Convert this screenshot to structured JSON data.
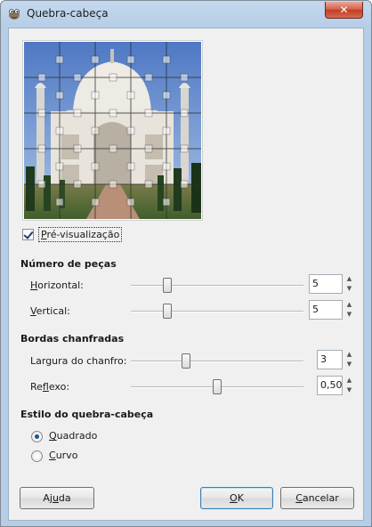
{
  "window": {
    "title": "Quebra-cabeça",
    "close_glyph": "✕",
    "icon": "gimp-icon"
  },
  "preview_toggle": {
    "label_mnemonic": "P",
    "label_rest": "ré-visualização",
    "checked": true
  },
  "pieces": {
    "heading": "Número de peças",
    "horizontal": {
      "label_mnemonic": "H",
      "label_rest": "orizontal:",
      "value": "5",
      "fraction": 0.21
    },
    "vertical": {
      "label_mnemonic": "V",
      "label_rest": "ertical:",
      "value": "5",
      "fraction": 0.21
    }
  },
  "bevel": {
    "heading": "Bordas chanfradas",
    "width": {
      "label_pre": "Largura do chanfro",
      "label_post": ":",
      "value": "3",
      "fraction": 0.32
    },
    "highlight": {
      "label_pre": "Re",
      "label_mnemonic": "f",
      "label_rest": "lexo:",
      "value": "0,50",
      "fraction": 0.5
    }
  },
  "style": {
    "heading": "Estilo do quebra-cabeça",
    "options": [
      {
        "label_mnemonic": "Q",
        "label_rest": "uadrado",
        "checked": true
      },
      {
        "label_mnemonic": "C",
        "label_rest": "urvo",
        "checked": false
      }
    ]
  },
  "buttons": {
    "help_pre": "Aj",
    "help_mnemonic": "u",
    "help_rest": "da",
    "ok_mnemonic": "O",
    "ok_rest": "K",
    "cancel_mnemonic": "C",
    "cancel_rest": "ancelar"
  },
  "spin_up": "▲",
  "spin_down": "▼",
  "colors": {
    "accent": "#3c7fb1",
    "title_bar": "#c4d9ef",
    "dialog_bg": "#f0f0f0"
  }
}
